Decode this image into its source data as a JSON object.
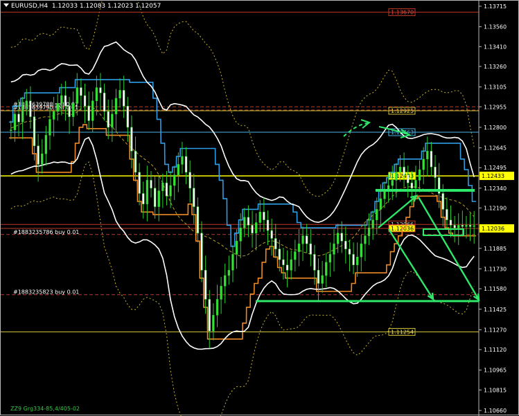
{
  "header": {
    "symbol": "EURUSD,H4",
    "ohlc": "1.12033 1.12083 1.12023 1.12057"
  },
  "footer": {
    "text": "ZZ9 Grg334-85,4/405-02"
  },
  "chart_data": {
    "type": "candlestick",
    "ylim": [
      1.1066,
      1.13715
    ],
    "y_ticks": [
      "1.13715",
      "1.13560",
      "1.13410",
      "1.13260",
      "1.13105",
      "1.12955",
      "1.12800",
      "1.12645",
      "1.12495",
      "1.12340",
      "1.12190",
      "1.12035",
      "1.11885",
      "1.11730",
      "1.11580",
      "1.11425",
      "1.11270",
      "1.11120",
      "1.10965",
      "1.10815",
      "1.10660"
    ],
    "x_count": 120,
    "close": [
      1.1278,
      1.129,
      1.1284,
      1.1296,
      1.13,
      1.1288,
      1.1266,
      1.1252,
      1.126,
      1.1274,
      1.1286,
      1.1292,
      1.1298,
      1.1304,
      1.1296,
      1.1288,
      1.1298,
      1.131,
      1.1304,
      1.1296,
      1.1285,
      1.13,
      1.131,
      1.1306,
      1.1292,
      1.128,
      1.129,
      1.1302,
      1.1308,
      1.1296,
      1.128,
      1.1262,
      1.1246,
      1.123,
      1.1222,
      1.124,
      1.1234,
      1.122,
      1.1232,
      1.1238,
      1.1228,
      1.1236,
      1.1244,
      1.1252,
      1.1258,
      1.1246,
      1.1234,
      1.122,
      1.12,
      1.1172,
      1.115,
      1.1126,
      1.1138,
      1.115,
      1.116,
      1.1168,
      1.1172,
      1.1184,
      1.1194,
      1.1204,
      1.1212,
      1.1206,
      1.12,
      1.1208,
      1.1216,
      1.121,
      1.1202,
      1.1196,
      1.1188,
      1.118,
      1.1176,
      1.1172,
      1.118,
      1.1186,
      1.1192,
      1.1198,
      1.1192,
      1.1184,
      1.1172,
      1.1162,
      1.1168,
      1.1178,
      1.1184,
      1.1192,
      1.12,
      1.1194,
      1.1188,
      1.1184,
      1.1176,
      1.1182,
      1.1192,
      1.1198,
      1.1204,
      1.121,
      1.1218,
      1.1226,
      1.1232,
      1.1236,
      1.124,
      1.1246,
      1.125,
      1.1244,
      1.1238,
      1.1234,
      1.124,
      1.1248,
      1.1256,
      1.1262,
      1.125,
      1.1242,
      1.123,
      1.1218,
      1.121,
      1.1206,
      1.1204,
      1.1206,
      1.1205,
      1.1206,
      1.1205,
      1.12057
    ],
    "levels": [
      {
        "price": 1.1367,
        "color": "#c0392b",
        "label": "1.13670",
        "label_color": "#e74c3c"
      },
      {
        "price": 1.12925,
        "color": "#d4c23a",
        "label": "1.12925",
        "label_color": "#f1e05a"
      },
      {
        "price": 1.12763,
        "color": "#4ab6e8",
        "label": "1.12763",
        "label_color": "#4ab6e8"
      },
      {
        "price": 1.12433,
        "color": "#ffff00",
        "label": "1.12433",
        "label_color": "#000000",
        "label_bg": "#ffff00"
      },
      {
        "price": 1.12066,
        "color": "#c0392b",
        "label": "1.12066",
        "label_color": "#cccccc"
      },
      {
        "price": 1.12036,
        "color": "#c0392b",
        "label": "1.12036",
        "label_color": "#000000",
        "label_bg": "#ffff00"
      },
      {
        "price": 1.11254,
        "color": "#d4c23a",
        "label": "1.11254",
        "label_color": "#f1e05a"
      }
    ],
    "orders": [
      {
        "price": 1.12955,
        "text": "#1881639788 sell 0.01"
      },
      {
        "price": 1.1293,
        "text": "#1881639790 sell 0.01"
      },
      {
        "price": 1.1199,
        "text": "#1883235786 buy 0.01"
      },
      {
        "price": 1.11535,
        "text": "#1883235823 buy 0.01"
      }
    ],
    "arrows_color": "#2ee86a"
  }
}
